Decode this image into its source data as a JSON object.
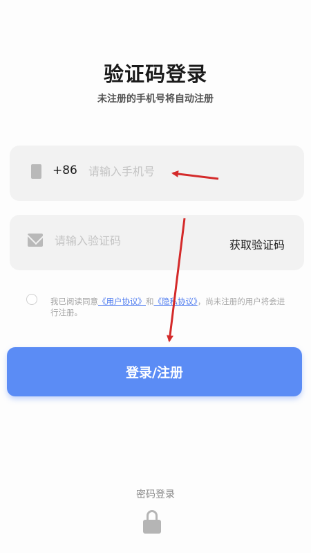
{
  "header": {
    "title": "验证码登录",
    "subtitle": "未注册的手机号将自动注册"
  },
  "phone_field": {
    "icon": "phone-icon",
    "prefix": "+86",
    "placeholder": "请输入手机号",
    "value": ""
  },
  "code_field": {
    "icon": "mail-icon",
    "placeholder": "请输入验证码",
    "value": "",
    "get_code_label": "获取验证码"
  },
  "agreement": {
    "checked": false,
    "prefix": "我已阅读同意",
    "user_agreement": "《用户协议》",
    "conjunction": "和",
    "privacy_policy": "《隐私协议》",
    "suffix": "，尚未注册的用户将会进行注册。"
  },
  "submit": {
    "label": "登录/注册"
  },
  "footer": {
    "password_login_label": "密码登录",
    "lock_icon": "lock-icon"
  },
  "colors": {
    "primary": "#5b8cf5",
    "link": "#4f7cf0",
    "field_bg": "#f2f2f2",
    "annotation_arrow": "#d42a2a"
  }
}
